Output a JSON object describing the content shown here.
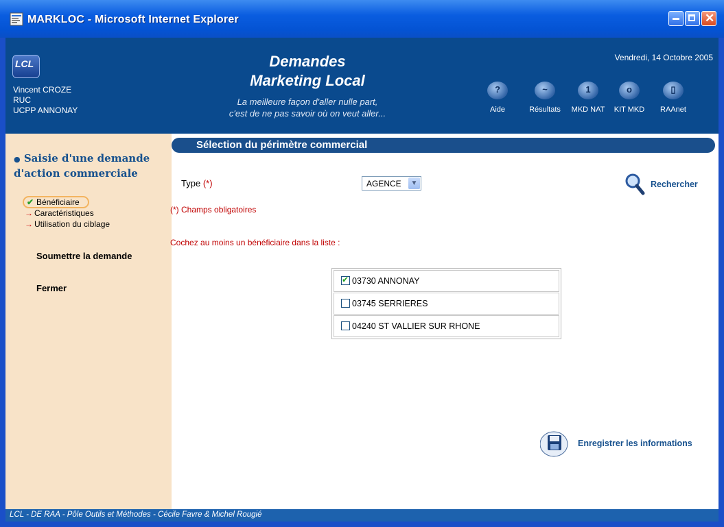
{
  "window": {
    "title": "MARKLOC - Microsoft Internet Explorer"
  },
  "header": {
    "logo_text": "LCL",
    "user_name": "Vincent CROZE",
    "user_role": "RUC",
    "user_unit": "UCPP ANNONAY",
    "title_line1": "Demandes",
    "title_line2": "Marketing Local",
    "tagline_line1": "La meilleure façon d'aller nulle part,",
    "tagline_line2": "c'est de ne pas savoir où on veut aller...",
    "date": "Vendredi, 14 Octobre 2005",
    "nav": [
      {
        "label": "Aide",
        "icon": "help-icon",
        "glyph": "?"
      },
      {
        "label": "Résultats",
        "icon": "results-icon",
        "glyph": "~"
      },
      {
        "label": "MKD NAT",
        "icon": "mkd-nat-icon",
        "glyph": "1"
      },
      {
        "label": "KIT MKD",
        "icon": "kit-mkd-icon",
        "glyph": "o"
      },
      {
        "label": "RAAnet",
        "icon": "raanet-icon",
        "glyph": "▯"
      }
    ]
  },
  "sidebar": {
    "heading": "Saisie d'une demande d'action commerciale",
    "steps": [
      {
        "label": "Bénéficiaire",
        "mark": "✔",
        "active": true
      },
      {
        "label": "Caractéristiques",
        "mark": "→",
        "active": false
      },
      {
        "label": "Utilisation du ciblage",
        "mark": "→",
        "active": false
      }
    ],
    "submit_label": "Soumettre la demande",
    "close_label": "Fermer"
  },
  "main": {
    "section_title": "Sélection du périmètre commercial",
    "type_label": "Type",
    "required_mark": "(*)",
    "type_value": "AGENCE",
    "search_label": "Rechercher",
    "required_note": "(*) Champs obligatoires",
    "instruction": "Cochez au moins un bénéficiaire dans la liste :",
    "beneficiaries": [
      {
        "label": "03730 ANNONAY",
        "checked": true
      },
      {
        "label": "03745 SERRIERES",
        "checked": false
      },
      {
        "label": "04240 ST VALLIER SUR RHONE",
        "checked": false
      }
    ],
    "save_label": "Enregistrer les informations"
  },
  "footer": {
    "text": "LCL - DE RAA - Pôle Outils et Méthodes - Cécile Favre & Michel Rougié"
  },
  "colors": {
    "header_bg": "#0a4a8e",
    "sidebar_bg": "#f8e3c8",
    "accent_text": "#17518e",
    "required_red": "#c00000"
  }
}
